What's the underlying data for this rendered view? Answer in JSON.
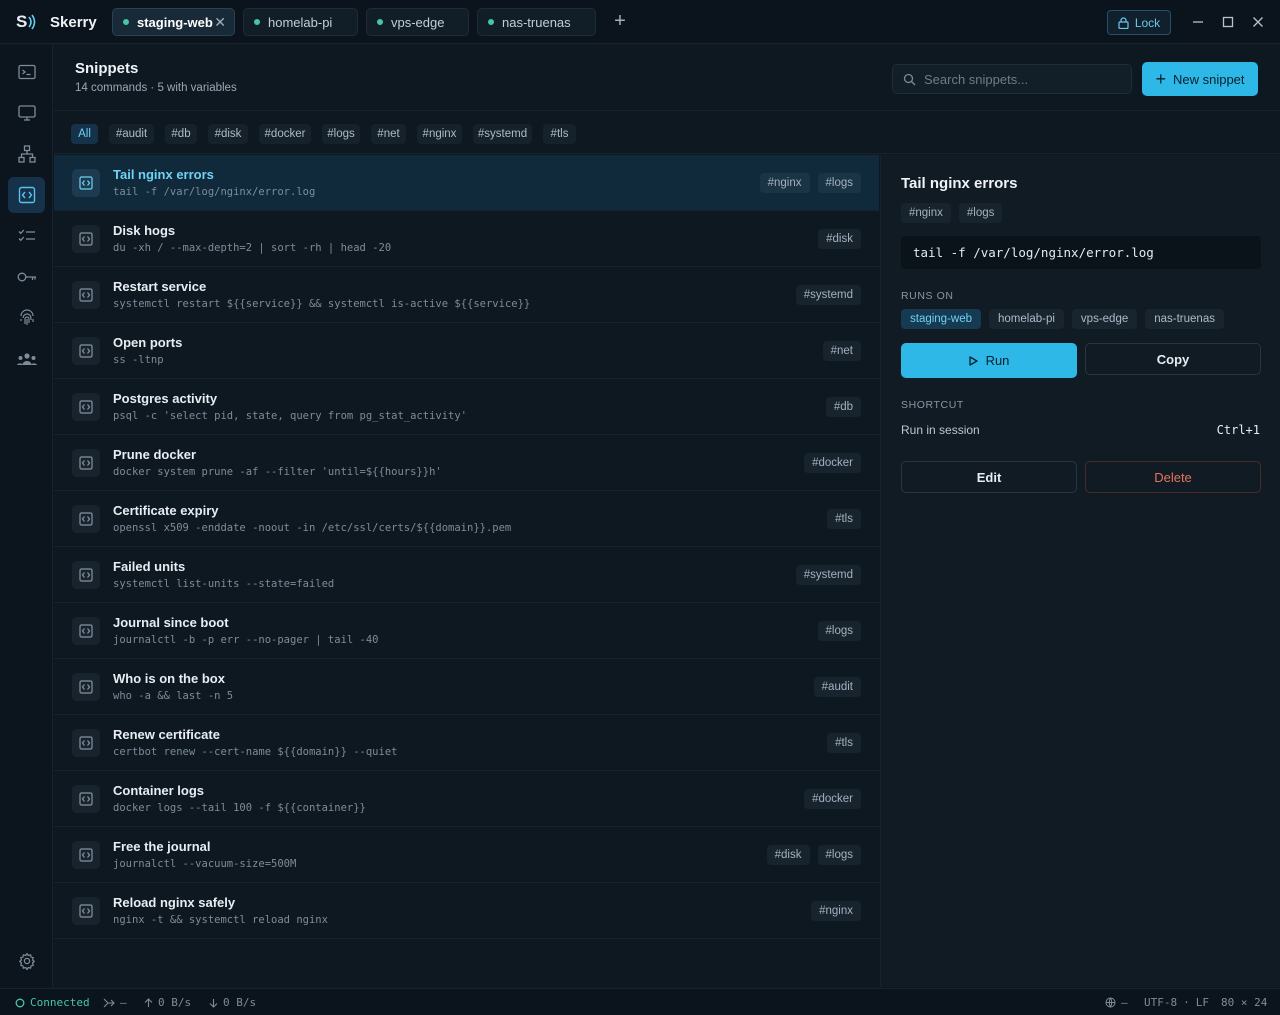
{
  "app": {
    "name": "Skerry",
    "logo_letter": "S"
  },
  "tabs": [
    {
      "label": "staging-web",
      "active": true
    },
    {
      "label": "homelab-pi",
      "active": false
    },
    {
      "label": "vps-edge",
      "active": false
    },
    {
      "label": "nas-truenas",
      "active": false
    }
  ],
  "titlebar": {
    "lock_label": "Lock"
  },
  "sidebar": {
    "items": [
      {
        "icon": "terminal-icon"
      },
      {
        "icon": "monitor-icon"
      },
      {
        "icon": "network-icon"
      },
      {
        "icon": "snippet-icon",
        "active": true
      },
      {
        "icon": "checklist-icon"
      },
      {
        "icon": "key-icon"
      },
      {
        "icon": "fingerprint-icon"
      },
      {
        "icon": "team-icon"
      }
    ],
    "settings_icon": "gear-icon"
  },
  "header": {
    "title": "Snippets",
    "subtitle": "14 commands · 5 with variables",
    "search_placeholder": "Search snippets...",
    "new_button": "New snippet"
  },
  "filters": [
    "All",
    "#audit",
    "#db",
    "#disk",
    "#docker",
    "#logs",
    "#net",
    "#nginx",
    "#systemd",
    "#tls"
  ],
  "snippets": [
    {
      "title": "Tail nginx errors",
      "command": "tail -f /var/log/nginx/error.log",
      "tags": [
        "#nginx",
        "#logs"
      ]
    },
    {
      "title": "Disk hogs",
      "command": "du -xh / --max-depth=2 | sort -rh | head -20",
      "tags": [
        "#disk"
      ]
    },
    {
      "title": "Restart service",
      "command": "systemctl restart ${{service}} && systemctl is-active ${{service}}",
      "tags": [
        "#systemd"
      ]
    },
    {
      "title": "Open ports",
      "command": "ss -ltnp",
      "tags": [
        "#net"
      ]
    },
    {
      "title": "Postgres activity",
      "command": "psql -c 'select pid, state, query from pg_stat_activity'",
      "tags": [
        "#db"
      ]
    },
    {
      "title": "Prune docker",
      "command": "docker system prune -af --filter 'until=${{hours}}h'",
      "tags": [
        "#docker"
      ]
    },
    {
      "title": "Certificate expiry",
      "command": "openssl x509 -enddate -noout -in /etc/ssl/certs/${{domain}}.pem",
      "tags": [
        "#tls"
      ]
    },
    {
      "title": "Failed units",
      "command": "systemctl list-units --state=failed",
      "tags": [
        "#systemd"
      ]
    },
    {
      "title": "Journal since boot",
      "command": "journalctl -b -p err --no-pager | tail -40",
      "tags": [
        "#logs"
      ]
    },
    {
      "title": "Who is on the box",
      "command": "who -a && last -n 5",
      "tags": [
        "#audit"
      ]
    },
    {
      "title": "Renew certificate",
      "command": "certbot renew --cert-name ${{domain}} --quiet",
      "tags": [
        "#tls"
      ]
    },
    {
      "title": "Container logs",
      "command": "docker logs --tail 100 -f ${{container}}",
      "tags": [
        "#docker"
      ]
    },
    {
      "title": "Free the journal",
      "command": "journalctl --vacuum-size=500M",
      "tags": [
        "#disk",
        "#logs"
      ]
    },
    {
      "title": "Reload nginx safely",
      "command": "nginx -t && systemctl reload nginx",
      "tags": [
        "#nginx"
      ]
    }
  ],
  "detail": {
    "title": "Tail nginx errors",
    "tags": [
      "#nginx",
      "#logs"
    ],
    "command": "tail -f /var/log/nginx/error.log",
    "runs_on_label": "RUNS ON",
    "hosts": [
      {
        "label": "staging-web",
        "active": true
      },
      {
        "label": "homelab-pi",
        "active": false
      },
      {
        "label": "vps-edge",
        "active": false
      },
      {
        "label": "nas-truenas",
        "active": false
      }
    ],
    "run_label": "Run",
    "copy_label": "Copy",
    "shortcut_label": "SHORTCUT",
    "shortcut_desc": "Run in session",
    "shortcut_key": "Ctrl+1",
    "edit_label": "Edit",
    "delete_label": "Delete"
  },
  "status": {
    "connection": "Connected",
    "branch": "–",
    "upload": "0 B/s",
    "download": "0 B/s",
    "globe": "–",
    "encoding": "UTF-8",
    "line_ending": "LF",
    "dims": "80 × 24",
    "sep": "·"
  },
  "colors": {
    "accent": "#2eb8e8",
    "connected": "#45c7a4",
    "danger": "#e2735c"
  }
}
